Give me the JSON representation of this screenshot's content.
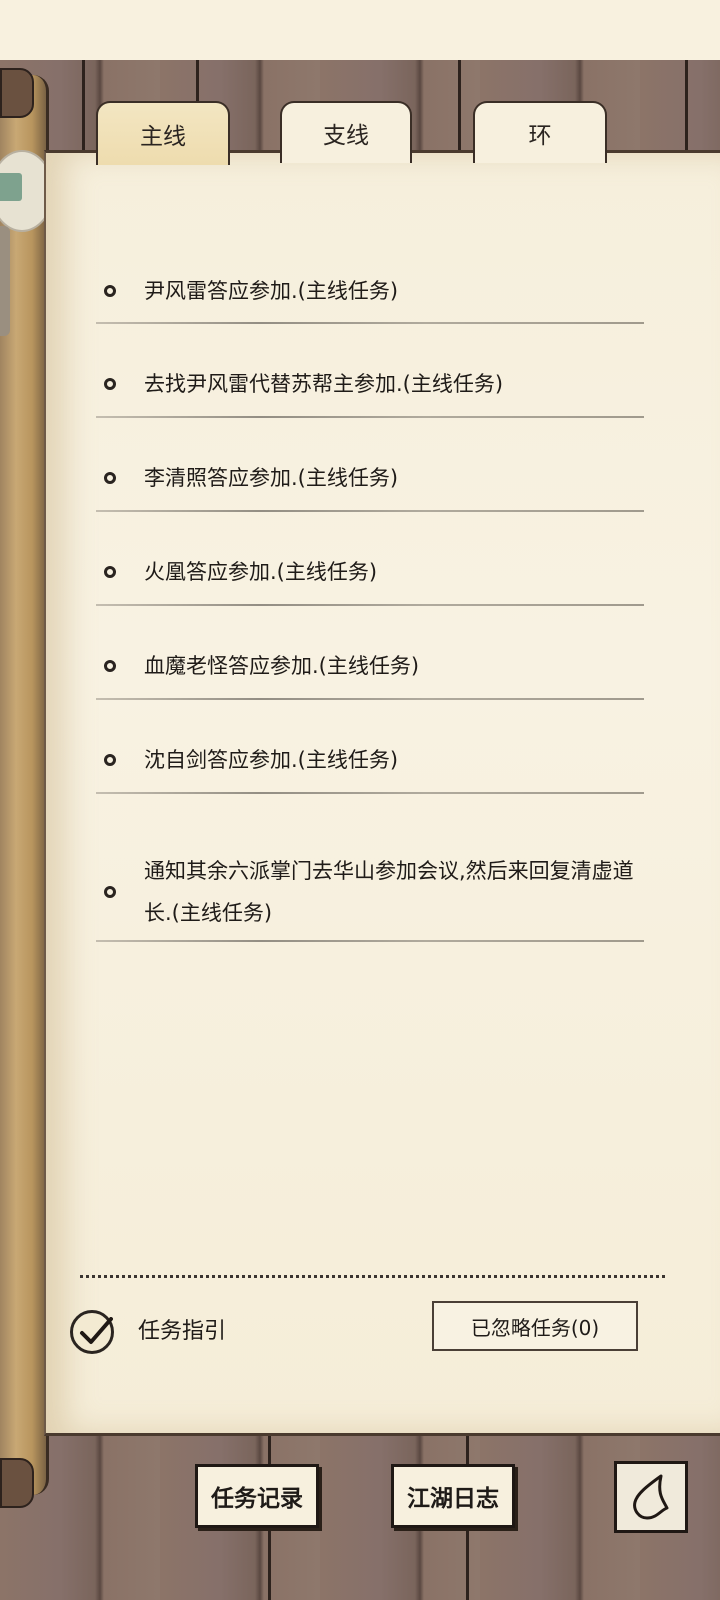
{
  "tabs": [
    {
      "label": "主线",
      "active": true
    },
    {
      "label": "支线",
      "active": false
    },
    {
      "label": "环",
      "active": false
    }
  ],
  "quests": [
    {
      "text": "尹风雷答应参加.(主线任务)"
    },
    {
      "text": "去找尹风雷代替苏帮主参加.(主线任务)"
    },
    {
      "text": "李清照答应参加.(主线任务)"
    },
    {
      "text": "火凰答应参加.(主线任务)"
    },
    {
      "text": "血魔老怪答应参加.(主线任务)"
    },
    {
      "text": "沈自剑答应参加.(主线任务)"
    },
    {
      "text": "通知其余六派掌门去华山参加会议,然后来回复清虚道长.(主线任务)"
    }
  ],
  "guide": {
    "label": "任务指引",
    "checked": true
  },
  "ignored_button": {
    "label": "已忽略任务(0)"
  },
  "bottom": {
    "record_label": "任务记录",
    "journal_label": "江湖日志",
    "back_icon": "back-arrow-icon"
  },
  "side_badge_icon": "app-badge-icon"
}
